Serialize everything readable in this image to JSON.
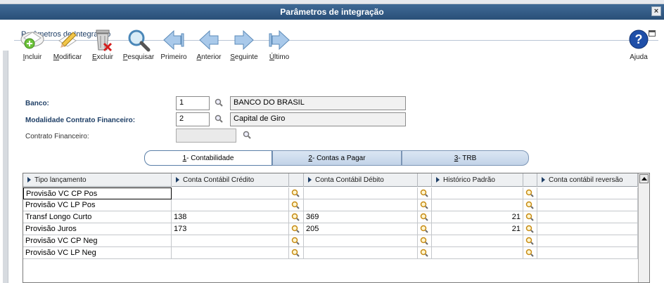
{
  "window": {
    "title": "Parâmetros de integração",
    "close_glyph": "×"
  },
  "panel": {
    "title": "Parâmetros de Integração"
  },
  "toolbar": {
    "incluir": {
      "label_u": "I",
      "label_rest": "ncluir",
      "icon": "add-person-icon"
    },
    "modificar": {
      "label_u": "M",
      "label_rest": "odificar",
      "icon": "edit-pencil-icon"
    },
    "excluir": {
      "label_u": "E",
      "label_rest": "xcluir",
      "icon": "trash-icon"
    },
    "pesquisar": {
      "label_u": "P",
      "label_rest": "esquisar",
      "icon": "magnifier-icon"
    },
    "primeiro": {
      "label_u": "",
      "label_rest": "Primeiro",
      "icon": "first-arrow-icon"
    },
    "anterior": {
      "label_u": "A",
      "label_rest": "nterior",
      "icon": "prev-arrow-icon"
    },
    "seguinte": {
      "label_u": "S",
      "label_rest": "eguinte",
      "icon": "next-arrow-icon"
    },
    "ultimo": {
      "label_u": "Ú",
      "label_rest": "ltimo",
      "icon": "last-arrow-icon"
    },
    "ajuda": {
      "label": "Ajuda",
      "icon": "help-icon"
    }
  },
  "form": {
    "banco": {
      "label": "Banco:",
      "code": "1",
      "desc": "BANCO DO BRASIL"
    },
    "modalidade": {
      "label": "Modalidade Contrato Financeiro:",
      "code": "2",
      "desc": "Capital de Giro"
    },
    "contrato": {
      "label": "Contrato Financeiro:",
      "code": ""
    }
  },
  "tabs": [
    {
      "u": "1",
      "rest": " - Contabilidade",
      "active": true
    },
    {
      "u": "2",
      "rest": " - Contas a Pagar",
      "active": false
    },
    {
      "u": "3",
      "rest": " - TRB",
      "active": false
    }
  ],
  "grid": {
    "columns": [
      "Tipo lançamento",
      "Conta Contábil Crédito",
      "Conta Contábil Débito",
      "Histórico Padrão",
      "Conta contábil reversão"
    ],
    "rows": [
      {
        "tipo": "Provisão VC CP Pos",
        "credito": "",
        "debito": "",
        "historico": "",
        "reversao": ""
      },
      {
        "tipo": "Provisão VC LP Pos",
        "credito": "",
        "debito": "",
        "historico": "",
        "reversao": ""
      },
      {
        "tipo": "Transf Longo Curto",
        "credito": "138",
        "debito": "369",
        "historico": "21",
        "reversao": ""
      },
      {
        "tipo": "Provisão Juros",
        "credito": "173",
        "debito": "205",
        "historico": "21",
        "reversao": ""
      },
      {
        "tipo": "Provisão VC CP Neg",
        "credito": "",
        "debito": "",
        "historico": "",
        "reversao": ""
      },
      {
        "tipo": "Provisão VC LP Neg",
        "credito": "",
        "debito": "",
        "historico": "",
        "reversao": ""
      }
    ]
  }
}
